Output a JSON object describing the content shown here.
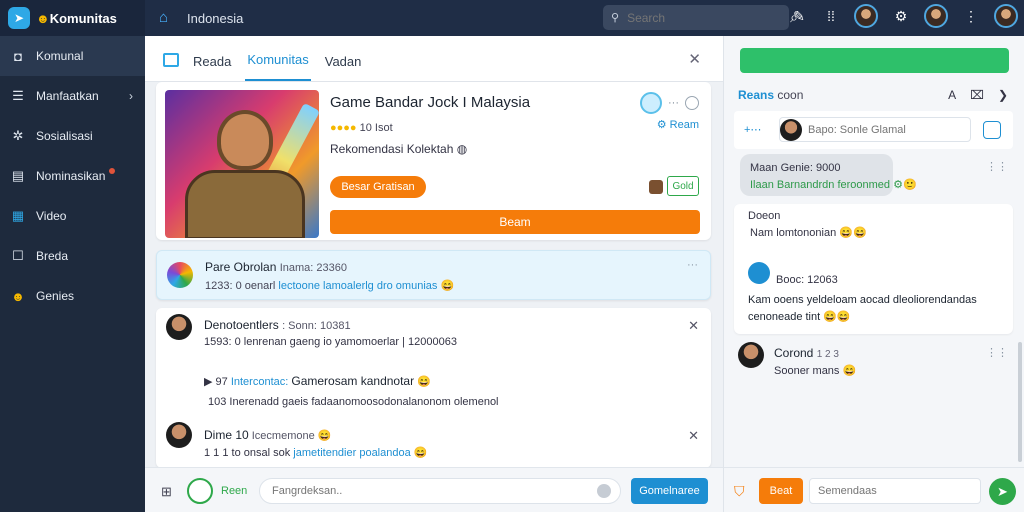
{
  "topbar": {
    "brand": "Komunitas",
    "crumb": "Indonesia",
    "search_placeholder": "Search"
  },
  "sidebar": {
    "items": [
      {
        "label": "Komunal",
        "icon": "camera-icon"
      },
      {
        "label": "Manfaatkan",
        "icon": "list-icon"
      },
      {
        "label": "Sosialisasi",
        "icon": "gear-icon"
      },
      {
        "label": "Nominasikan",
        "icon": "news-icon"
      },
      {
        "label": "Video",
        "icon": "grid-icon"
      },
      {
        "label": "Breda",
        "icon": "square-icon"
      },
      {
        "label": "Genies",
        "icon": "smile-icon"
      }
    ]
  },
  "tabs": [
    "Reada",
    "Komunitas",
    "Vadan"
  ],
  "game_card": {
    "title": "Game Bandar Jock I Malaysia",
    "meta": "10 Isot",
    "desc": "Rekomendasi Kolektah",
    "team_label": "Ream",
    "primary_btn": "Besar Gratisan",
    "ghost_btn": "Gold",
    "wide_btn": "Beam"
  },
  "feed_row": {
    "title": "Pare Obrolan",
    "title_meta": "Inama: 23360",
    "sub_prefix": "1233: 0 oenarl",
    "sub_link": "lectoone lamoalerlg dro omunias"
  },
  "thread": {
    "name": "Denotoentlers",
    "name_meta": ": Sonn: 10381",
    "line1": "1593: 0 lenrenan gaeng io yamomoerlar | 12000063",
    "line2_prefix": "▶ 97",
    "line2_link": "Intercontac:",
    "line2_text": "Gamerosam kandnotar",
    "line3": "103  Inerenadd gaeis fadaanomoosodonalanonom olemenol",
    "reply_name": "Dime 10",
    "reply_meta": "Icecmemone",
    "reply_prefix": "1 1 1  to onsal sok",
    "reply_link": "jametitendier poalandoa"
  },
  "composer": {
    "label": "Reen",
    "placeholder": "Fangrdeksan..",
    "send": "Gomelnaree"
  },
  "right": {
    "title": "Reans",
    "title_meta": "coon",
    "search_placeholder": "Bapo: Sonle Glamal",
    "bubble_line1": "Maan Genie: 9000",
    "bubble_line2": "Ilaan Barnandrdn feroonmed",
    "card1_head": "Doeon",
    "card1_line": "Nam lomtononian",
    "card1_meta": "Booc: 12063",
    "card1_text1": "Kam ooens yeldeloam aocad dleoliorendandas",
    "card1_text2": "cenoneade tint",
    "user_name": "Corond",
    "user_meta": "1 2 3",
    "user_sub": "Sooner mans",
    "btn": "Beat",
    "placeholder": "Semendaas"
  }
}
